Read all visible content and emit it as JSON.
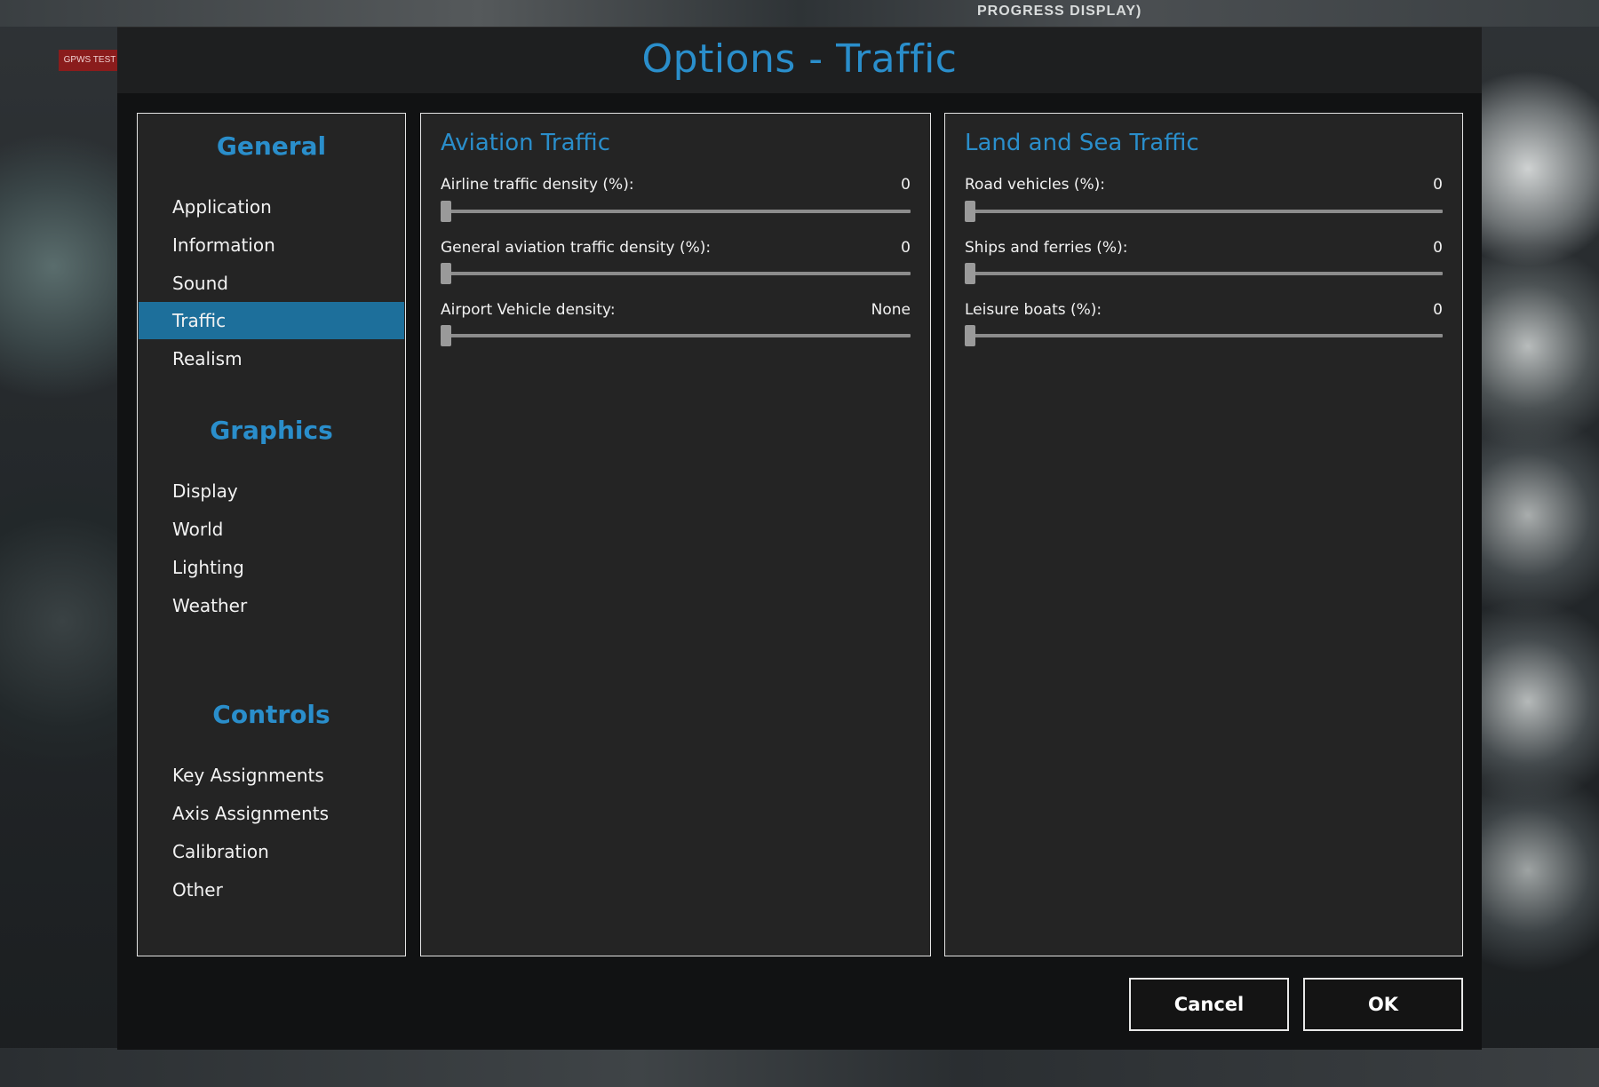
{
  "background": {
    "label": "PROGRESS DISPLAY)",
    "left_button": "GPWS TEST"
  },
  "dialog": {
    "title": "Options - Traffic"
  },
  "nav": {
    "sections": [
      {
        "heading": "General",
        "items": [
          "Application",
          "Information",
          "Sound",
          "Traffic",
          "Realism"
        ]
      },
      {
        "heading": "Graphics",
        "items": [
          "Display",
          "World",
          "Lighting",
          "Weather"
        ]
      },
      {
        "heading": "Controls",
        "items": [
          "Key Assignments",
          "Axis Assignments",
          "Calibration",
          "Other"
        ]
      }
    ],
    "active_item": "Traffic"
  },
  "aviation": {
    "title": "Aviation Traffic",
    "settings": [
      {
        "label": "Airline traffic density (%):",
        "value": "0",
        "fraction": 0
      },
      {
        "label": "General aviation traffic density (%):",
        "value": "0",
        "fraction": 0
      },
      {
        "label": "Airport Vehicle density:",
        "value": "None",
        "fraction": 0
      }
    ]
  },
  "landsea": {
    "title": "Land and Sea Traffic",
    "settings": [
      {
        "label": "Road vehicles (%):",
        "value": "0",
        "fraction": 0
      },
      {
        "label": "Ships and ferries (%):",
        "value": "0",
        "fraction": 0
      },
      {
        "label": "Leisure boats (%):",
        "value": "0",
        "fraction": 0
      }
    ]
  },
  "buttons": {
    "cancel": "Cancel",
    "ok": "OK"
  },
  "colors": {
    "accent": "#2a8ecb",
    "active_nav": "#1d6f9b",
    "panel_bg": "#242424",
    "dialog_bg": "#111213"
  }
}
